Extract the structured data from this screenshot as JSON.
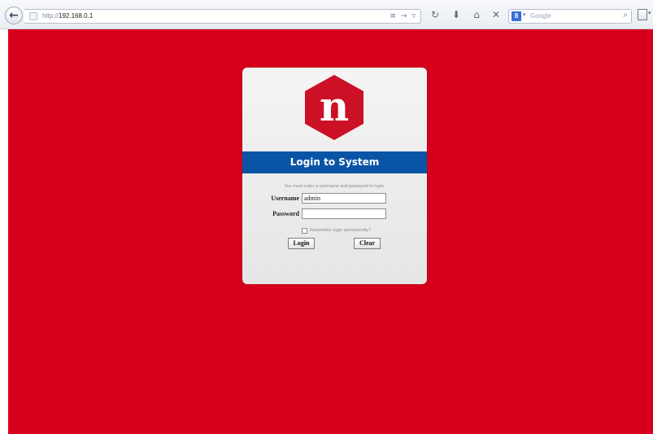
{
  "browser": {
    "url_protocol": "http://",
    "url_host": "192.168.0.1",
    "search_placeholder": "Google",
    "search_engine_letter": "8"
  },
  "login": {
    "logo_letter": "n",
    "title": "Login to System",
    "instruction": "You must enter a username and password to login.",
    "username_label": "Username",
    "username_value": "admin",
    "password_label": "Password",
    "password_value": "",
    "remember_label": "Remember login permanently?",
    "remember_checked": false,
    "login_button": "Login",
    "clear_button": "Clear"
  },
  "colors": {
    "page_background": "#d6001c",
    "title_bar": "#0a54a6",
    "logo": "#cc1126"
  },
  "icons": {
    "back": "arrow-left-icon",
    "reload": "reload-icon",
    "download": "download-icon",
    "home": "home-icon",
    "stop": "close-icon",
    "search": "search-icon",
    "menu": "menu-icon"
  }
}
